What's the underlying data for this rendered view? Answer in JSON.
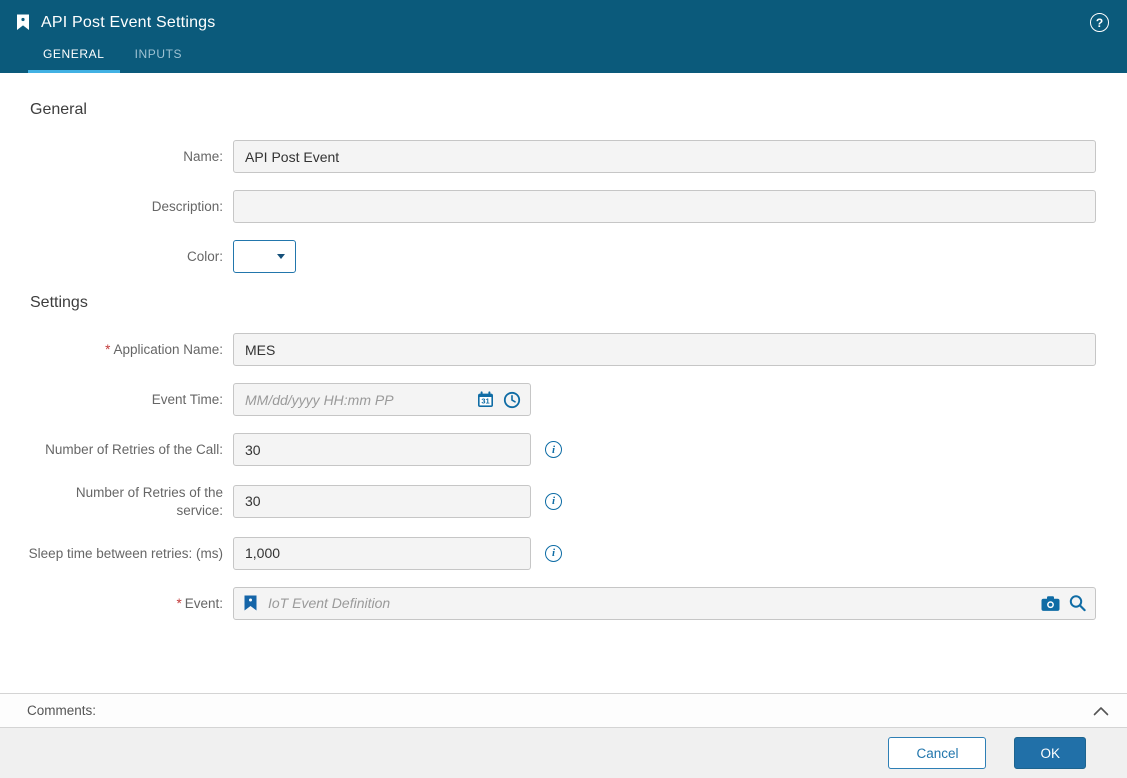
{
  "header": {
    "title": "API Post Event Settings",
    "help_glyph": "?",
    "tabs": [
      {
        "label": "GENERAL",
        "active": true
      },
      {
        "label": "INPUTS",
        "active": false
      }
    ]
  },
  "general": {
    "heading": "General",
    "fields": {
      "name": {
        "label": "Name:",
        "value": "API Post Event"
      },
      "description": {
        "label": "Description:",
        "value": ""
      },
      "color": {
        "label": "Color:",
        "value": ""
      }
    }
  },
  "settings": {
    "heading": "Settings",
    "fields": {
      "application_name": {
        "label": "Application Name:",
        "required_marker": "*",
        "value": "MES"
      },
      "event_time": {
        "label": "Event Time:",
        "placeholder": "MM/dd/yyyy HH:mm PP",
        "calendar_day": "31"
      },
      "retries_call": {
        "label": "Number of Retries of the Call:",
        "value": "30",
        "info_glyph": "i"
      },
      "retries_service": {
        "label": "Number of Retries of the service:",
        "value": "30",
        "info_glyph": "i"
      },
      "sleep_time": {
        "label": "Sleep time between retries: (ms)",
        "value": "1,000",
        "info_glyph": "i"
      },
      "event": {
        "label": "Event:",
        "required_marker": "*",
        "placeholder": "IoT Event Definition"
      }
    }
  },
  "comments": {
    "label": "Comments:"
  },
  "footer": {
    "cancel_label": "Cancel",
    "ok_label": "OK"
  },
  "colors": {
    "header_bg": "#0b5a7b",
    "tab_underline": "#41b1e3",
    "accent": "#2276ac",
    "icon_blue": "#0f6ca5",
    "required": "#c23b3b",
    "input_bg": "#f4f4f4",
    "footer_bg": "#f0f0f0"
  }
}
